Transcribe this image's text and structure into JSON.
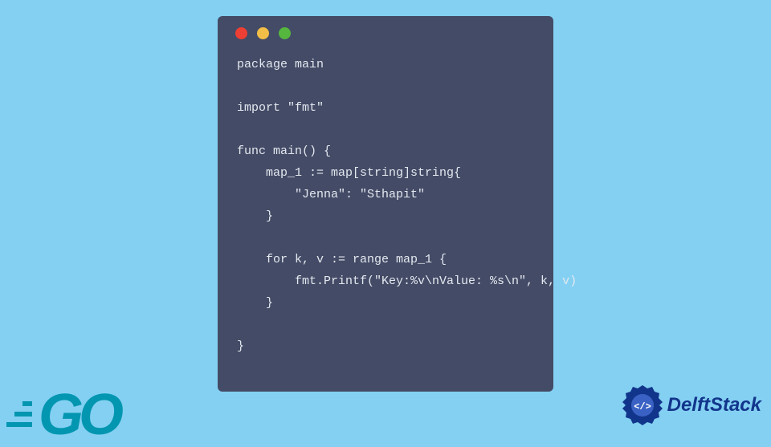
{
  "code": {
    "line1": "package main",
    "line2": "",
    "line3": "import \"fmt\"",
    "line4": "",
    "line5": "func main() {",
    "line6": "    map_1 := map[string]string{",
    "line7": "        \"Jenna\": \"Sthapit\"",
    "line8": "    }",
    "line9": "",
    "line10": "    for k, v := range map_1 {",
    "line11": "        fmt.Printf(\"Key:%v\\nValue: %s\\n\", k, v)",
    "line12": "    }",
    "line13": "",
    "line14": "}"
  },
  "logos": {
    "go": "GO",
    "delftstack": "DelftStack"
  }
}
